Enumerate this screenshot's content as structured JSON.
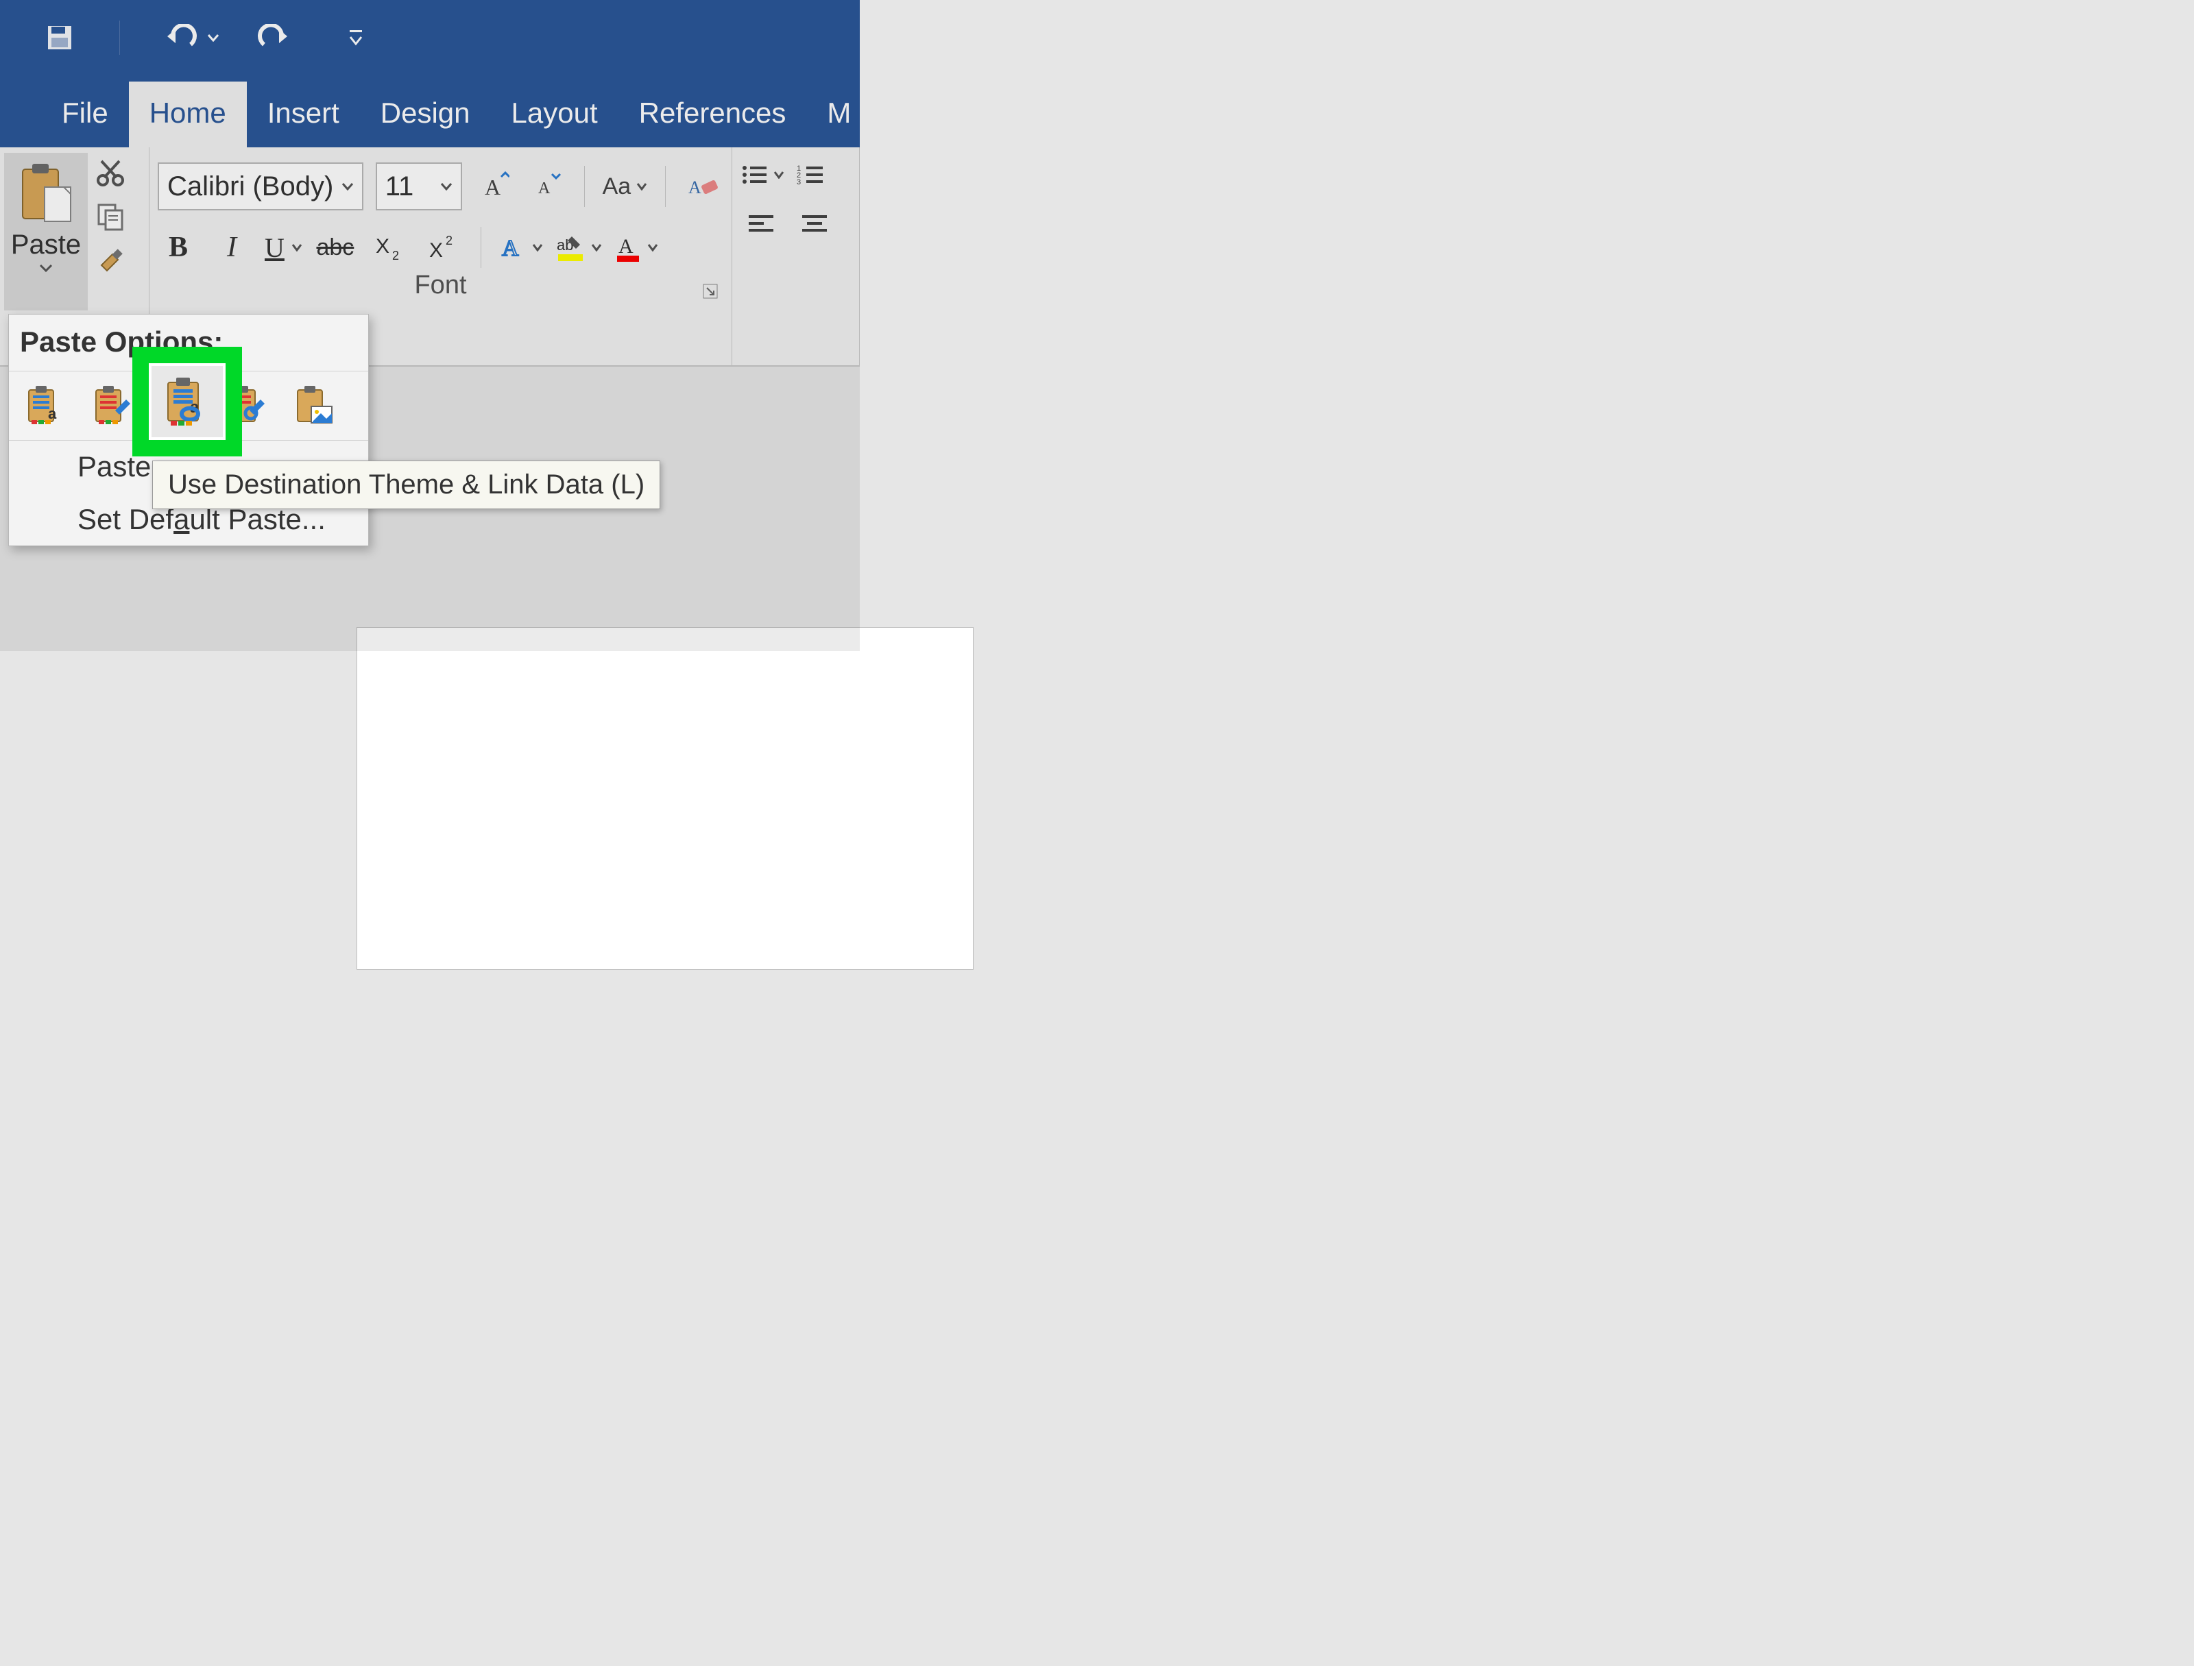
{
  "qat": {
    "save": "save-icon",
    "undo": "undo-icon",
    "redo": "redo-icon",
    "customize": "customize-qat-icon"
  },
  "tabs": {
    "file": "File",
    "home": "Home",
    "insert": "Insert",
    "design": "Design",
    "layout": "Layout",
    "references": "References",
    "mail_partial": "M"
  },
  "active_tab": "home",
  "clipboard": {
    "paste_label": "Paste"
  },
  "font": {
    "family": "Calibri (Body)",
    "size": "11",
    "group_label": "Font",
    "change_case": "Aa"
  },
  "paste_menu": {
    "header": "Paste Options:",
    "paste_special": "Paste",
    "set_default": "Set Default Paste...",
    "tooltip": "Use Destination Theme & Link Data (L)"
  }
}
